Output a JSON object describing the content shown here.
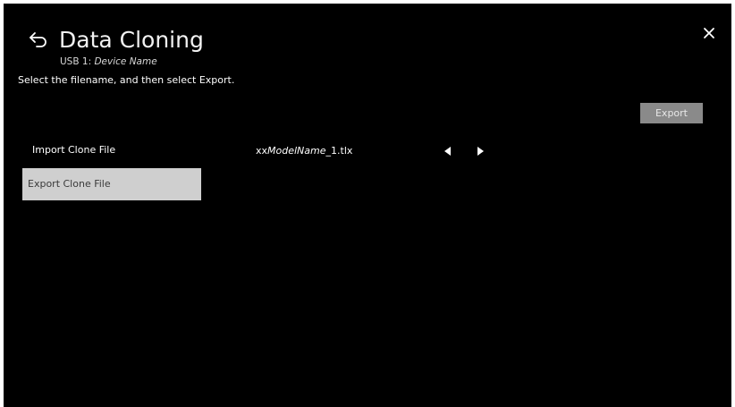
{
  "header": {
    "title": "Data Cloning",
    "subtitle_prefix": "USB 1: ",
    "subtitle_device": "Device Name",
    "instruction": "Select the filename, and then select Export.",
    "back_icon": "back-arrow-icon",
    "close_icon": "close-icon"
  },
  "actions": {
    "export_label": "Export"
  },
  "menu": {
    "items": [
      {
        "label": "Import Clone File",
        "selected": false
      },
      {
        "label": "Export Clone File",
        "selected": true
      }
    ]
  },
  "file_selector": {
    "prefix": "xx",
    "model": "ModelName",
    "suffix": "_1.tlx",
    "prev_icon": "triangle-left-icon",
    "next_icon": "triangle-right-icon"
  },
  "colors": {
    "background": "#000000",
    "selected_item": "#cfcfcf",
    "export_button": "#8a8a8a"
  }
}
